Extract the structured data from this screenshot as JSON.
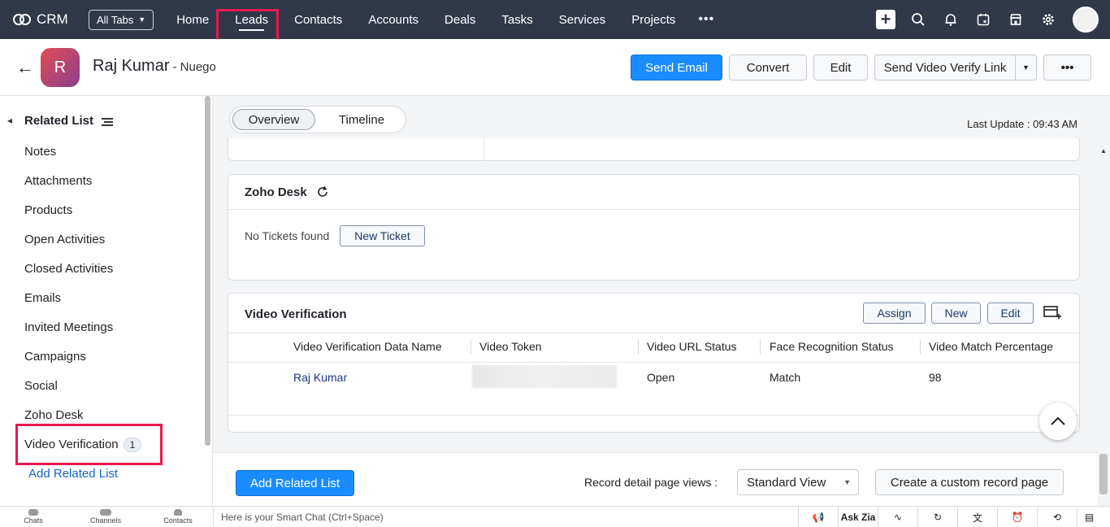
{
  "topnav": {
    "app_name": "CRM",
    "all_tabs_label": "All Tabs",
    "tabs": [
      "Home",
      "Leads",
      "Contacts",
      "Accounts",
      "Deals",
      "Tasks",
      "Services",
      "Projects"
    ],
    "more_label": "•••",
    "active_tab": "Leads"
  },
  "record": {
    "initial": "R",
    "name": "Raj Kumar",
    "company": "- Nuego"
  },
  "actions": {
    "send_email": "Send Email",
    "convert": "Convert",
    "edit": "Edit",
    "send_video_verify": "Send Video Verify Link",
    "more": "•••"
  },
  "sidebar": {
    "title": "Related List",
    "items": [
      "Notes",
      "Attachments",
      "Products",
      "Open Activities",
      "Closed Activities",
      "Emails",
      "Invited Meetings",
      "Campaigns",
      "Social",
      "Zoho Desk"
    ],
    "video_verification": {
      "label": "Video Verification",
      "count": "1"
    },
    "add_related_list": "Add Related List"
  },
  "view_tabs": {
    "overview": "Overview",
    "timeline": "Timeline"
  },
  "last_update": "Last Update : 09:43 AM",
  "zoho_desk": {
    "title": "Zoho Desk",
    "no_tickets": "No Tickets found",
    "new_ticket": "New Ticket"
  },
  "video_verification": {
    "title": "Video Verification",
    "buttons": {
      "assign": "Assign",
      "new": "New",
      "edit": "Edit"
    },
    "columns": [
      "Video Verification Data Name",
      "Video Token",
      "Video URL Status",
      "Face Recognition Status",
      "Video Match Percentage"
    ],
    "rows": [
      {
        "name": "Raj Kumar",
        "token": "",
        "url_status": "Open",
        "face_status": "Match",
        "match_pct": "98"
      }
    ]
  },
  "footer": {
    "add_related_list": "Add Related List",
    "views_label": "Record detail page views :",
    "view_select": "Standard View",
    "create_custom": "Create a custom record page"
  },
  "bottombar": {
    "items": [
      "Chats",
      "Channels",
      "Contacts"
    ],
    "smart_chat": "Here is your Smart Chat (Ctrl+Space)",
    "ask_zia": "Ask Zia"
  },
  "colors": {
    "nav_bg": "#313949",
    "primary": "#1a8cff",
    "highlight": "#e8194f",
    "link": "#1463c7"
  }
}
